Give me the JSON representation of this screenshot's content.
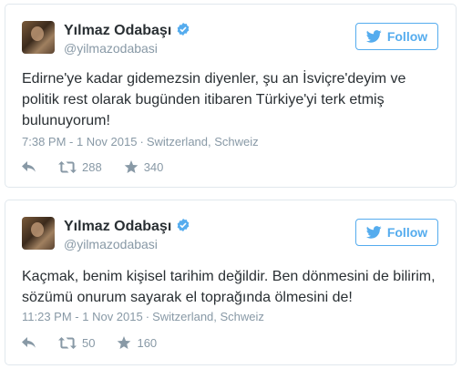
{
  "tweets": [
    {
      "name": "Yılmaz Odabaşı",
      "handle": "@yilmazodabasi",
      "follow_label": "Follow",
      "text": "Edirne'ye kadar gidemezsin diyenler, şu an İsviçre'deyim ve politik rest olarak bugünden itibaren Türkiye'yi terk etmiş bulunuyorum!",
      "time": "7:38 PM - 1 Nov 2015",
      "location": "Switzerland, Schweiz",
      "retweets": "288",
      "likes": "340"
    },
    {
      "name": "Yılmaz Odabaşı",
      "handle": "@yilmazodabasi",
      "follow_label": "Follow",
      "text": "Kaçmak, benim kişisel tarihim değildir. Ben dönmesini de bilirim, sözümü onurum sayarak el toprağında ölmesini de!",
      "time": "11:23 PM - 1 Nov 2015",
      "location": "Switzerland, Schweiz",
      "retweets": "50",
      "likes": "160"
    }
  ],
  "meta_separator": "·",
  "colors": {
    "accent": "#55acee",
    "muted": "#8899a6",
    "text": "#292f33",
    "border": "#e1e8ed"
  },
  "icons": [
    "verified-badge-icon",
    "twitter-bird-icon",
    "reply-icon",
    "retweet-icon",
    "star-icon"
  ]
}
